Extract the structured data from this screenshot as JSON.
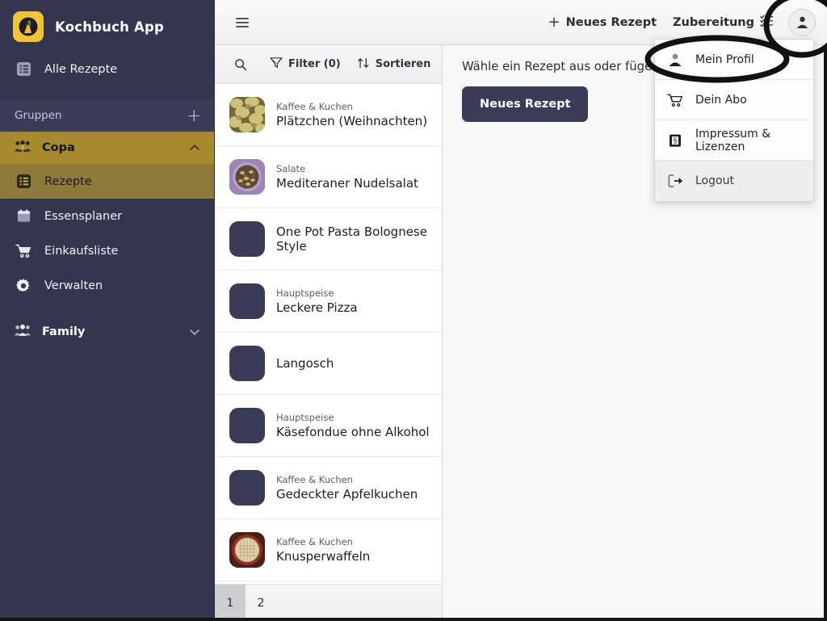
{
  "app": {
    "brand_title": "Kochbuch App",
    "logo_icon": "chef-logo-icon"
  },
  "sidebar": {
    "all_recipes": {
      "label": "Alle Rezepte",
      "icon": "list-icon"
    },
    "groups_header": {
      "label": "Gruppen",
      "add_label": "+",
      "add_icon": "plus-icon"
    },
    "groups": [
      {
        "name": "Copa",
        "icon": "group-people-icon",
        "expanded": true,
        "chevron": "chevron-up-icon",
        "items": [
          {
            "label": "Rezepte",
            "icon": "list-icon",
            "active": true
          },
          {
            "label": "Essensplaner",
            "icon": "calendar-icon",
            "active": false
          },
          {
            "label": "Einkaufsliste",
            "icon": "shopping-cart-icon",
            "active": false
          },
          {
            "label": "Verwalten",
            "icon": "gear-icon",
            "active": false
          }
        ]
      },
      {
        "name": "Family",
        "icon": "group-people-icon",
        "expanded": false,
        "chevron": "chevron-down-icon",
        "items": []
      }
    ]
  },
  "topbar": {
    "menu_icon": "hamburger-icon",
    "new_recipe": {
      "label": "Neues Rezept",
      "icon": "plus-icon"
    },
    "preparation": {
      "label": "Zubereitung",
      "icon": "checklist-icon"
    },
    "avatar_icon": "user-avatar-icon"
  },
  "list_toolbar": {
    "search_icon": "search-icon",
    "filter": {
      "label": "Filter (0)",
      "icon": "filter-icon"
    },
    "sort": {
      "label": "Sortieren",
      "icon": "sort-arrows-icon"
    }
  },
  "recipes": [
    {
      "category": "Kaffee & Kuchen",
      "name": "Plätzchen (Weihnachten)",
      "thumb": "cookies-photo"
    },
    {
      "category": "Salate",
      "name": "Mediteraner Nudelsalat",
      "thumb": "pastasalad-photo"
    },
    {
      "category": "",
      "name": "One Pot Pasta Bolognese Style",
      "thumb": "placeholder"
    },
    {
      "category": "Hauptspeise",
      "name": "Leckere Pizza",
      "thumb": "placeholder"
    },
    {
      "category": "",
      "name": "Langosch",
      "thumb": "placeholder"
    },
    {
      "category": "Hauptspeise",
      "name": "Käsefondue ohne Alkohol",
      "thumb": "placeholder"
    },
    {
      "category": "Kaffee & Kuchen",
      "name": "Gedeckter Apfelkuchen",
      "thumb": "placeholder"
    },
    {
      "category": "Kaffee & Kuchen",
      "name": "Knusperwaffeln",
      "thumb": "waffle-photo"
    }
  ],
  "pagination": {
    "pages": [
      "1",
      "2"
    ],
    "current": "1"
  },
  "main_pane": {
    "hint": "Wähle ein Rezept aus oder füge ein",
    "new_recipe_button": "Neues Rezept"
  },
  "profile_menu": {
    "items": [
      {
        "label": "Mein Profil",
        "icon": "user-icon"
      },
      {
        "label": "Dein Abo",
        "icon": "shopping-cart-icon"
      },
      {
        "label": "Impressum & Lizenzen",
        "icon": "book-paragraph-icon"
      },
      {
        "label": "Logout",
        "icon": "logout-icon"
      }
    ]
  },
  "colors": {
    "sidebar_bg": "#343650",
    "group_active": "#a78a2c",
    "subitem_active": "#8e7a3a",
    "accent_logo": "#f2c335",
    "primary_button": "#3a3c57",
    "pane_bg": "#f7f7f7"
  }
}
